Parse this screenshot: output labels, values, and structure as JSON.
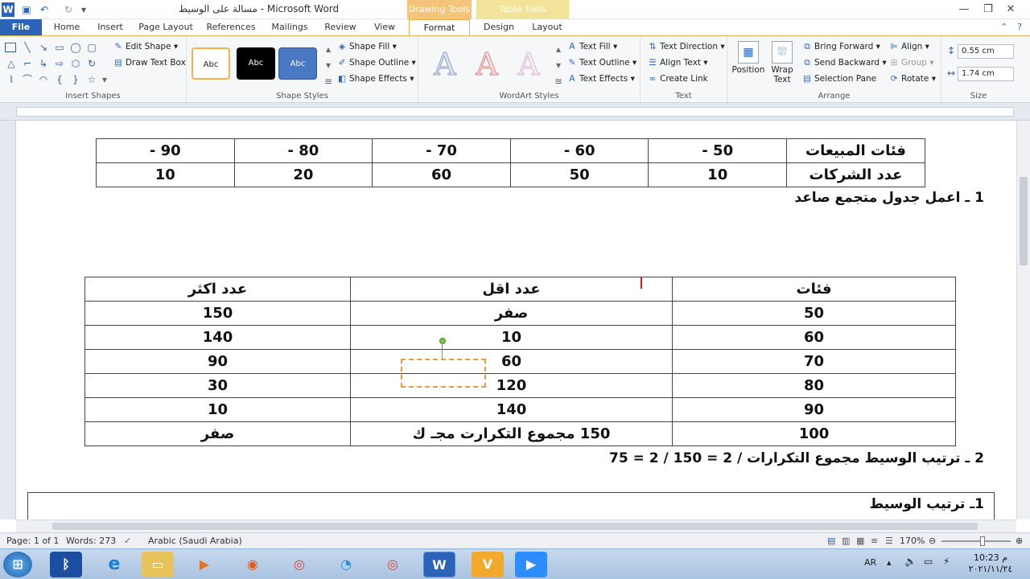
{
  "titlebar": {
    "title": "مسالة على الوسيط  -  Microsoft Word",
    "ctx_drawing": "Drawing Tools",
    "ctx_table": "Table Tools",
    "qat_icons": [
      "word-icon",
      "save-icon",
      "undo-icon",
      "redo-icon",
      "customize-icon"
    ]
  },
  "tabs": [
    "File",
    "Home",
    "Insert",
    "Page Layout",
    "References",
    "Mailings",
    "Review",
    "View",
    "Format",
    "Design",
    "Layout"
  ],
  "ribbon": {
    "insert_shapes": {
      "label": "Insert Shapes",
      "edit_shape": "Edit Shape",
      "draw_text_box": "Draw Text Box"
    },
    "shape_styles": {
      "label": "Shape Styles",
      "sample": "Abc",
      "fill": "Shape Fill",
      "outline": "Shape Outline",
      "effects": "Shape Effects"
    },
    "wordart_styles": {
      "label": "WordArt Styles",
      "letter": "A",
      "text_fill": "Text Fill",
      "text_outline": "Text Outline",
      "text_effects": "Text Effects"
    },
    "text": {
      "label": "Text",
      "direction": "Text Direction",
      "align": "Align Text",
      "link": "Create Link"
    },
    "arrange": {
      "label": "Arrange",
      "position": "Position",
      "wrap": "Wrap Text",
      "bring_forward": "Bring Forward",
      "send_backward": "Send Backward",
      "selection_pane": "Selection Pane",
      "align": "Align",
      "group": "Group",
      "rotate": "Rotate"
    },
    "size": {
      "label": "Size",
      "height": "0.55 cm",
      "width": "1.74 cm"
    }
  },
  "doc": {
    "table1": {
      "rows": [
        [
          "فئات المبيعات",
          "50 -",
          "60 -",
          "70 -",
          "80 -",
          "90 -"
        ],
        [
          "عدد الشركات",
          "10",
          "50",
          "60",
          "20",
          "10"
        ]
      ]
    },
    "q1": "1 ـ اعمل جدول متجمع صاعد",
    "table2": {
      "header": [
        "فئات",
        "عدد اقل",
        "عدد اكثر"
      ],
      "rows": [
        [
          "50",
          "صفر",
          "150"
        ],
        [
          "60",
          "10",
          "140"
        ],
        [
          "70",
          "60",
          "90"
        ],
        [
          "80",
          "120",
          "30"
        ],
        [
          "90",
          "140",
          "10"
        ],
        [
          "100",
          "150   مجموع التكرارت  مجـ ك",
          "صفر"
        ]
      ]
    },
    "q2": "2 ـ ترتيب الوسيط    مجموع التكرارات / 2 =  150  / 2 = 75",
    "box_heading": "1ـ ترتيب الوسيط"
  },
  "status": {
    "page": "Page: 1 of 1",
    "words": "Words: 273",
    "lang": "Arabic (Saudi Arabia)",
    "zoom": "170%"
  },
  "taskbar": {
    "apps": [
      "start-icon",
      "bluetooth-icon",
      "ie-icon",
      "folder-icon",
      "media-icon",
      "firefox-icon",
      "chrome-icon",
      "edge-icon",
      "chrome-icon",
      "word-icon",
      "vcalc-icon",
      "zoom-icon"
    ],
    "lang": "AR",
    "time": "10:23 م",
    "date": "٢٠٢١/١١/٢٤"
  },
  "colors": {
    "file_tab": "#2b63b8",
    "drawing_ctx": "#f4c47a",
    "table_ctx": "#f3e39a",
    "selection": "#e89b3a"
  }
}
